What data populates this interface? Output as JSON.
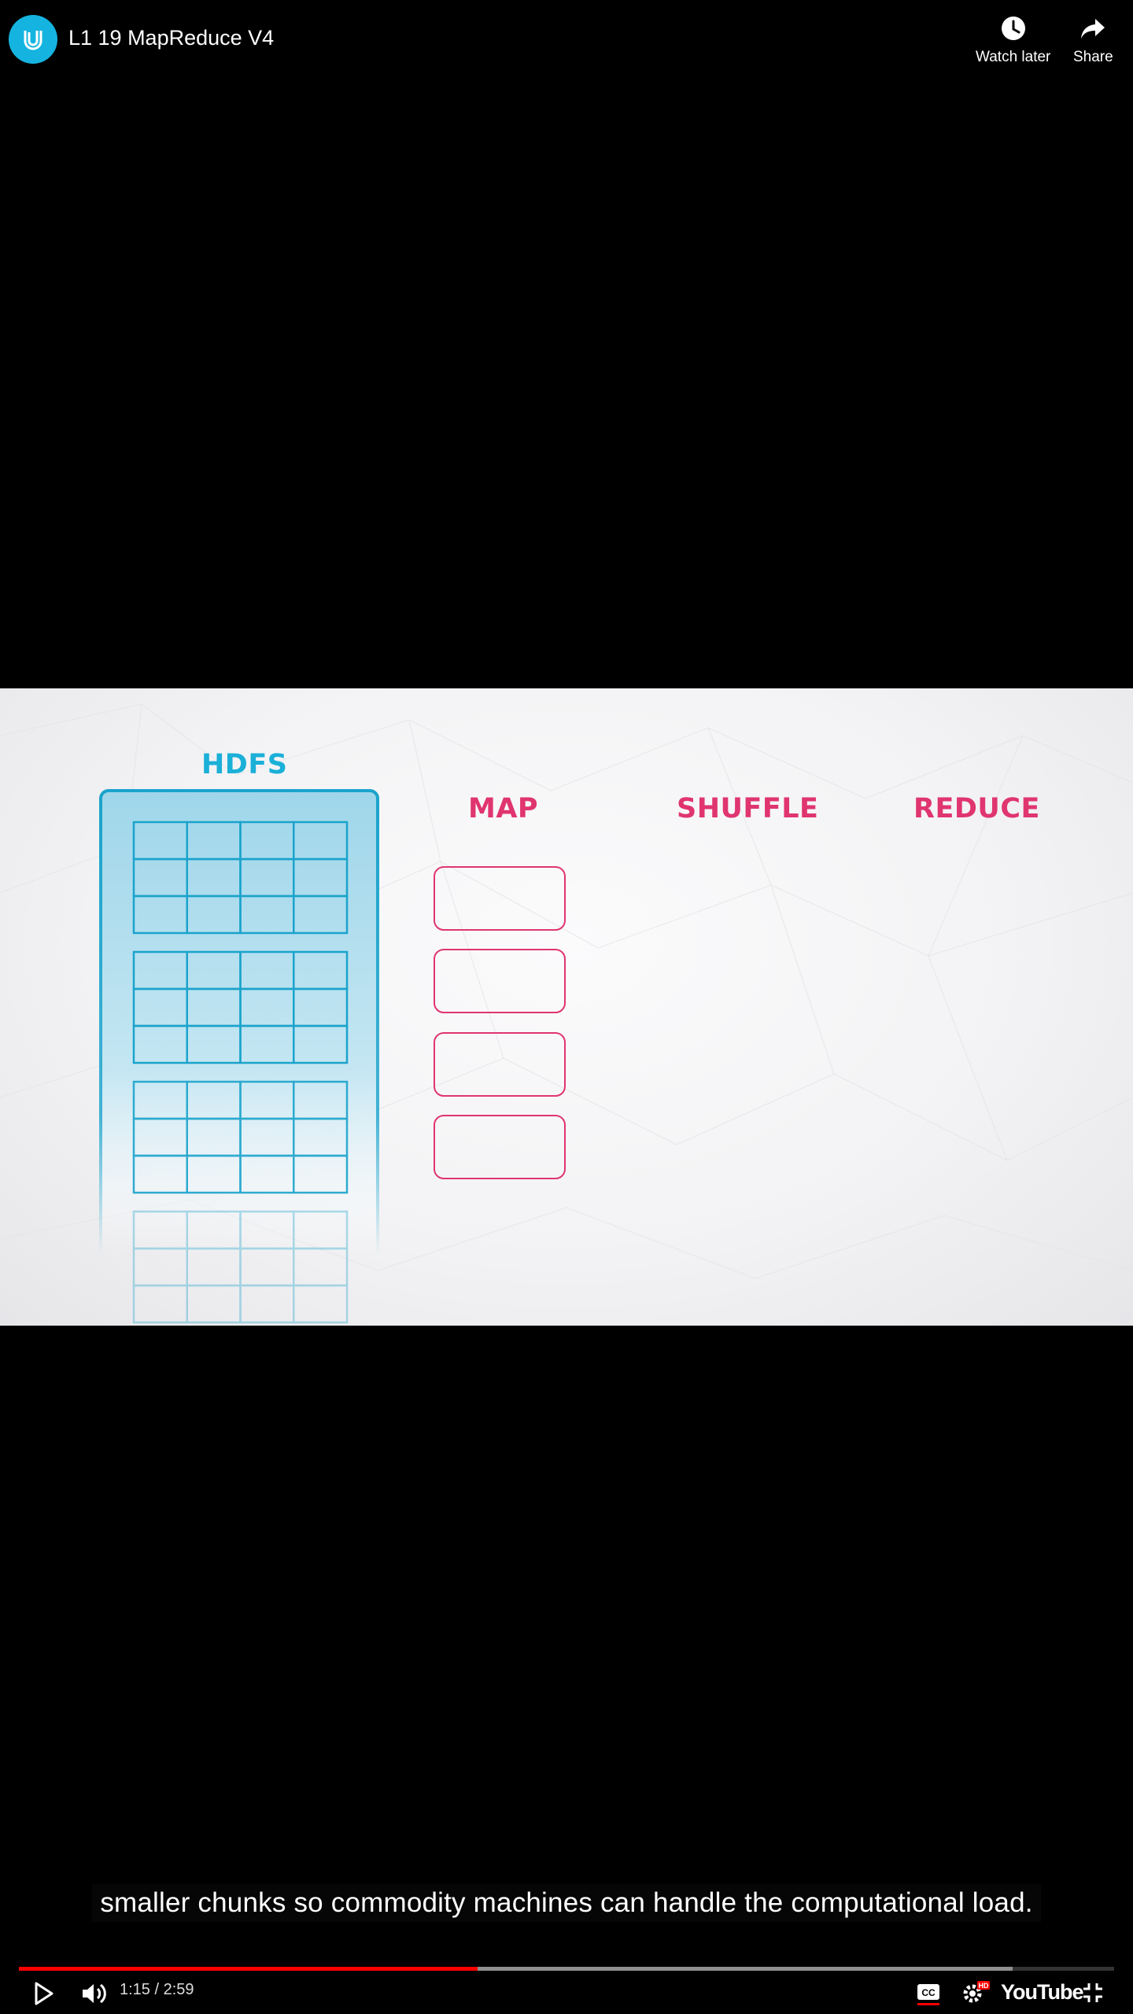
{
  "video": {
    "title": "L1 19 MapReduce V4",
    "current_time": "1:15",
    "duration": "2:59",
    "time_display": "1:15 / 2:59",
    "progress": 0.419,
    "buffered": 0.907
  },
  "top_actions": {
    "watch_later_label": "Watch later",
    "share_label": "Share"
  },
  "frame": {
    "hdfs_label": "HDFS",
    "map_label": "MAP",
    "shuffle_label": "SHUFFLE",
    "reduce_label": "REDUCE"
  },
  "caption": {
    "text": "smaller chunks so commodity machines can handle the computational load."
  },
  "controls": {
    "brand": "YouTube",
    "icons": [
      "play-icon",
      "volume-icon",
      "captions-icon",
      "settings-icon",
      "exit-fullscreen-icon"
    ],
    "hd_badge": "HD"
  },
  "colors": {
    "progress": "#ff0000",
    "hdfs_blue": "#1ab0d8",
    "stage_pink": "#e0356f",
    "channel_logo": "#15b4e0"
  }
}
